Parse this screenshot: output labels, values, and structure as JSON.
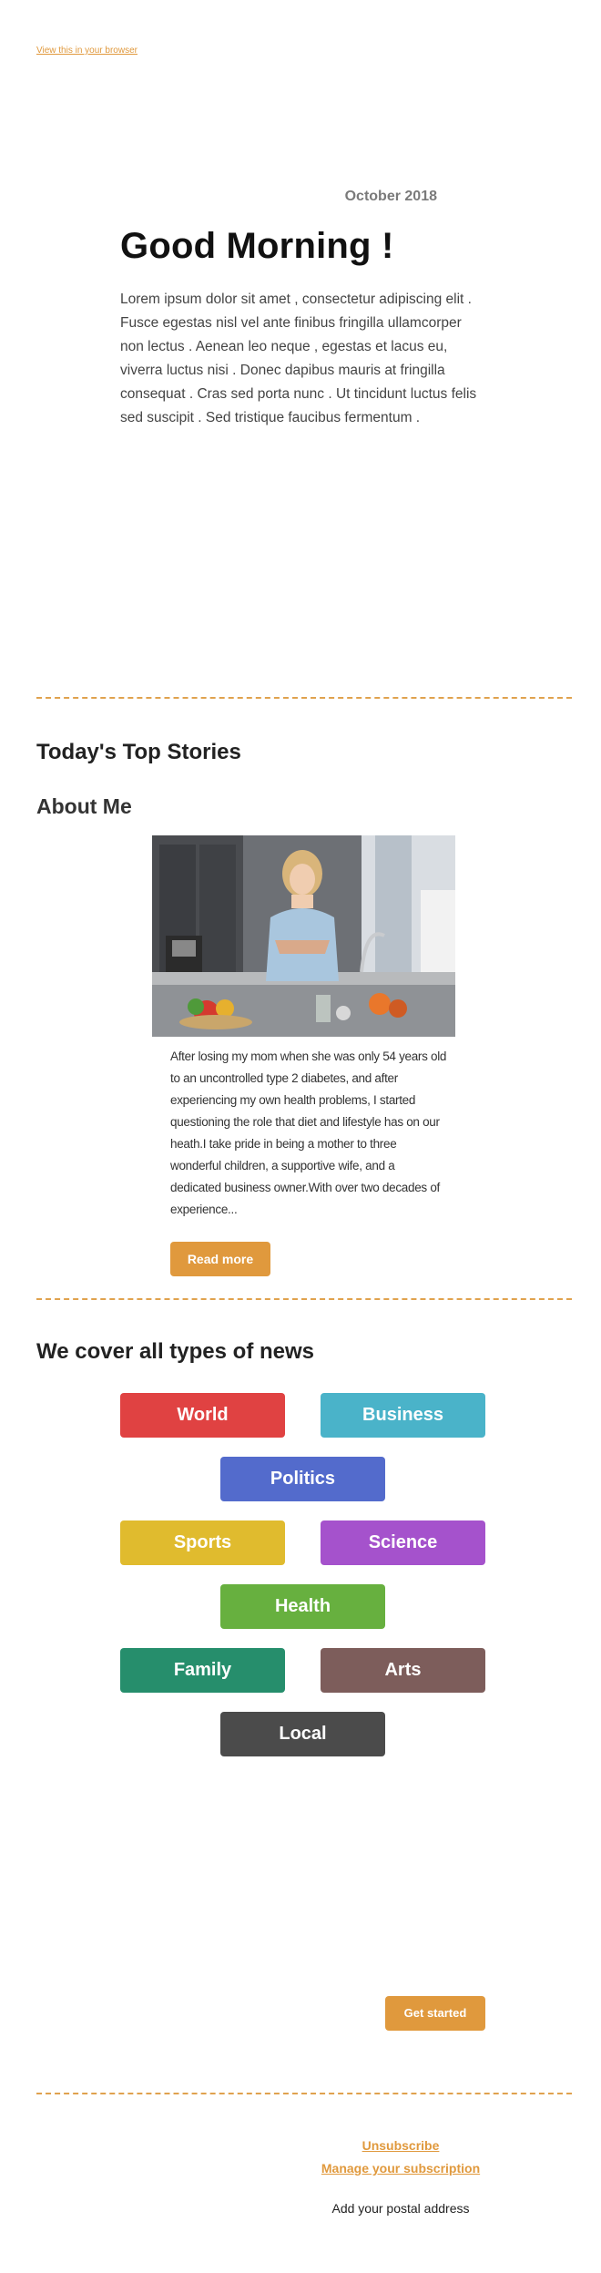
{
  "header": {
    "view_in_browser": "View this in your browser"
  },
  "hero": {
    "date": "October 2018",
    "greeting": "Good Morning !",
    "intro": "Lorem ipsum dolor sit amet , consectetur adipiscing elit . Fusce egestas nisl vel ante finibus fringilla ullamcorper non lectus . Aenean leo neque , egestas et lacus eu, viverra luctus nisi . Donec dapibus mauris at fringilla consequat . Cras sed porta nunc . Ut tincidunt luctus felis sed suscipit . Sed tristique faucibus fermentum ."
  },
  "stories": {
    "heading": "Today's Top Stories",
    "about_heading": "About Me",
    "bio": "After losing my mom when she was only 54 years old to an uncontrolled type 2 diabetes, and after experiencing my own health problems, I started questioning the role that diet and lifestyle has on our heath.I take pride in being a mother to three wonderful children, a supportive wife, and a dedicated business owner.With over two decades of experience...",
    "read_more": "Read more"
  },
  "news": {
    "heading": "We cover all types of news",
    "categories": [
      {
        "label": "World",
        "color": "#e04242"
      },
      {
        "label": "Business",
        "color": "#4ab3c9"
      },
      {
        "label": "Politics",
        "color": "#536bcc"
      },
      {
        "label": "Sports",
        "color": "#e0bb2e"
      },
      {
        "label": "Science",
        "color": "#a552cc"
      },
      {
        "label": "Health",
        "color": "#67b03f"
      },
      {
        "label": "Family",
        "color": "#268e6c"
      },
      {
        "label": "Arts",
        "color": "#7d5d5b"
      },
      {
        "label": "Local",
        "color": "#4b4b4b"
      }
    ],
    "get_started": "Get started"
  },
  "footer": {
    "unsubscribe": "Unsubscribe",
    "manage": "Manage your subscription",
    "postal": "Add your postal address"
  },
  "colors": {
    "accent": "#e0993d",
    "divider": "#e0a24e"
  }
}
